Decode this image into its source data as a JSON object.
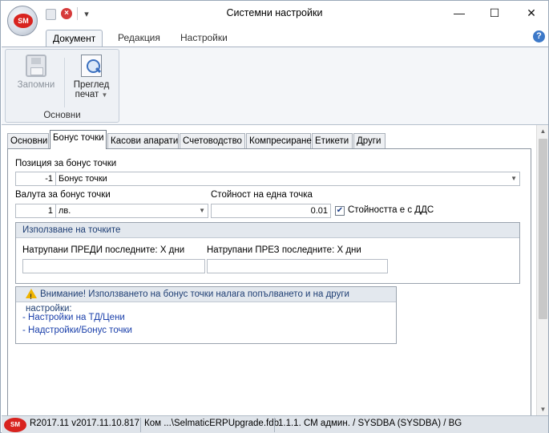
{
  "window": {
    "title": "Системни настройки",
    "app_logo": "SM"
  },
  "ribbon": {
    "tabs": [
      {
        "label": "Документ",
        "active": true
      },
      {
        "label": "Редакция",
        "active": false
      },
      {
        "label": "Настройки",
        "active": false
      }
    ],
    "group_label": "Основни",
    "save_label": "Запомни",
    "print_label_1": "Преглед",
    "print_label_2": "печат"
  },
  "doc_tabs": [
    {
      "label": "Основни",
      "active": false
    },
    {
      "label": "Бонус точки",
      "active": true
    },
    {
      "label": "Касови апарати",
      "active": false
    },
    {
      "label": "Счетоводство",
      "active": false
    },
    {
      "label": "Компресиране",
      "active": false
    },
    {
      "label": "Етикети",
      "active": false
    },
    {
      "label": "Други",
      "active": false
    }
  ],
  "form": {
    "position_label": "Позиция за бонус точки",
    "position_code": "-1",
    "position_value": "Бонус точки",
    "currency_label": "Валута за бонус точки",
    "currency_code": "1",
    "currency_value": "лв.",
    "point_value_label": "Стойност на една точка",
    "point_value": "0.01",
    "vat_checkbox_label": "Стойността е с ДДС",
    "vat_checked": true,
    "usage_group_title": "Използване на точките",
    "before_label": "Натрупани ПРЕДИ последните: X дни",
    "before_value": "",
    "during_label": "Натрупани ПРЕЗ последните: X дни",
    "during_value": "",
    "warning_text": "Внимание! Използването на бонус точки налага попълването и на други настройки:",
    "link_1": "- Настройки на ТД/Цени",
    "link_2": "- Надстройки/Бонус точки"
  },
  "statusbar": {
    "logo": "SM",
    "version": "R2017.11 v2017.11.10.817",
    "database": "Ком ...\\SelmaticERPUpgrade.fdb",
    "user": "1.1.1. СМ админ. / SYSDBA (SYSDBA) / BG"
  },
  "colors": {
    "accent": "#1f3f74",
    "link": "#1a3faa",
    "logo_red": "#d8231f"
  }
}
